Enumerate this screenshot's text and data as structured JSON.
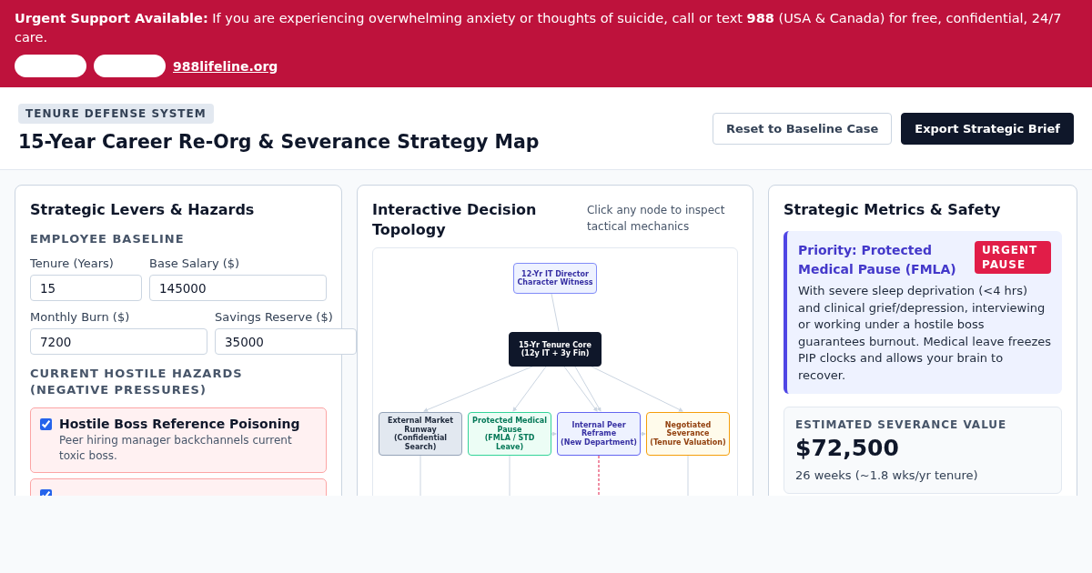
{
  "banner": {
    "message": "**Urgent Support Available:** If you are experiencing overwhelming anxiety or thoughts of suicide, call or text **988** (USA & Canada) for free, confidential, 24/7 care.",
    "link": "988lifeline.org"
  },
  "header": {
    "badge": "TENURE DEFENSE SYSTEM",
    "title": "15-Year Career Re-Org & Severance Strategy Map",
    "buttons": [
      {
        "label": "Reset to Baseline Case",
        "kind": "secondary"
      },
      {
        "label": "Export Strategic Brief",
        "kind": "primary"
      }
    ]
  },
  "levers": {
    "title": "Strategic Levers & Hazards",
    "baseline_heading": "EMPLOYEE BASELINE",
    "fields": [
      {
        "label": "Tenure (Years)",
        "value": "15"
      },
      {
        "label": "Base Salary ($)",
        "value": "145000"
      },
      {
        "label": "Monthly Burn ($)",
        "value": "7200"
      },
      {
        "label": "Savings Reserve ($)",
        "value": "35000"
      }
    ],
    "hazards_heading": "CURRENT HOSTILE HAZARDS (NEGATIVE PRESSURES)",
    "hazards": [
      {
        "title": "Hostile Boss Reference Poisoning",
        "description": "Peer hiring manager backchannels current toxic boss.",
        "checked": true
      },
      {
        "checked": true
      }
    ]
  },
  "topology": {
    "title": "Interactive Decision Topology",
    "hint": "Click any node to inspect tactical mechanics",
    "nodes": [
      {
        "kind": "witness",
        "lines": [
          "12-Yr IT Director",
          "Character Witness"
        ]
      },
      {
        "kind": "core",
        "lines": [
          "15-Yr Tenure Core",
          "(12y IT + 3y Fin)"
        ]
      },
      {
        "kind": "external",
        "lines": [
          "External Market Runway",
          "(Confidential Search)"
        ]
      },
      {
        "kind": "medical",
        "lines": [
          "Protected Medical Pause",
          "(FMLA / STD Leave)"
        ]
      },
      {
        "kind": "internal",
        "lines": [
          "Internal Peer Reframe",
          "(New Department)"
        ]
      },
      {
        "kind": "severance",
        "lines": [
          "Negotiated Severance",
          "(Tenure Valuation)"
        ]
      }
    ]
  },
  "metrics": {
    "title": "Strategic Metrics & Safety",
    "priority": {
      "title": "Priority: Protected Medical Pause (FMLA)",
      "badge": "URGENT PAUSE",
      "body": "With severe sleep deprivation (<4 hrs) and clinical grief/depression, interviewing or working under a hostile boss guarantees burnout. Medical leave freezes PIP clocks and allows your brain to recover."
    },
    "severance": {
      "label": "ESTIMATED SEVERANCE VALUE",
      "value": "$72,500",
      "note": "26 weeks (~1.8 wks/yr tenure)"
    }
  }
}
